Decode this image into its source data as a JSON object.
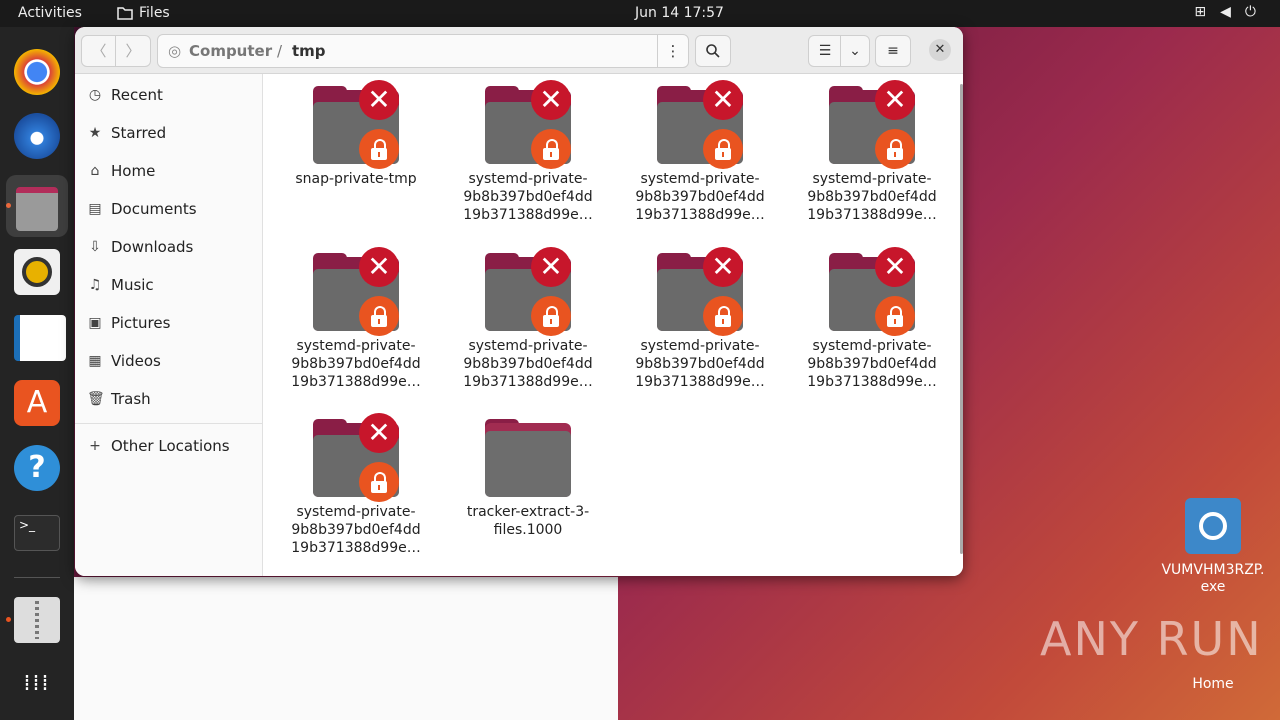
{
  "topbar": {
    "activities": "Activities",
    "app_name": "Files",
    "clock": "Jun 14  17:57",
    "tray": [
      "network-icon",
      "volume-icon",
      "power-icon"
    ]
  },
  "window": {
    "path": [
      "Computer",
      "/",
      "tmp"
    ]
  },
  "sidebar": {
    "items": [
      {
        "label": "Recent",
        "icon": "clock-icon"
      },
      {
        "label": "Starred",
        "icon": "star-icon"
      },
      {
        "label": "Home",
        "icon": "home-icon"
      },
      {
        "label": "Documents",
        "icon": "document-icon"
      },
      {
        "label": "Downloads",
        "icon": "download-icon"
      },
      {
        "label": "Music",
        "icon": "music-icon"
      },
      {
        "label": "Pictures",
        "icon": "picture-icon"
      },
      {
        "label": "Videos",
        "icon": "video-icon"
      },
      {
        "label": "Trash",
        "icon": "trash-icon"
      },
      {
        "label": "Other Locations",
        "icon": "plus-icon"
      }
    ]
  },
  "files": [
    {
      "line1": "snap-private-tmp",
      "line2": "",
      "line3": "",
      "locked": true
    },
    {
      "line1": "systemd-private-",
      "line2": "9b8b397bd0ef4dd",
      "line3": "19b371388d99e…",
      "locked": true
    },
    {
      "line1": "systemd-private-",
      "line2": "9b8b397bd0ef4dd",
      "line3": "19b371388d99e…",
      "locked": true
    },
    {
      "line1": "systemd-private-",
      "line2": "9b8b397bd0ef4dd",
      "line3": "19b371388d99e…",
      "locked": true
    },
    {
      "line1": "systemd-private-",
      "line2": "9b8b397bd0ef4dd",
      "line3": "19b371388d99e…",
      "locked": true
    },
    {
      "line1": "systemd-private-",
      "line2": "9b8b397bd0ef4dd",
      "line3": "19b371388d99e…",
      "locked": true
    },
    {
      "line1": "systemd-private-",
      "line2": "9b8b397bd0ef4dd",
      "line3": "19b371388d99e…",
      "locked": true
    },
    {
      "line1": "systemd-private-",
      "line2": "9b8b397bd0ef4dd",
      "line3": "19b371388d99e…",
      "locked": true
    },
    {
      "line1": "systemd-private-",
      "line2": "9b8b397bd0ef4dd",
      "line3": "19b371388d99e…",
      "locked": true
    },
    {
      "line1": "tracker-extract-3-",
      "line2": "files.1000",
      "line3": "",
      "locked": false
    }
  ],
  "desktop": {
    "exe_label_1": "VUMVHM3RZP.",
    "exe_label_2": "exe",
    "home_label": "Home",
    "watermark": "ANY RUN"
  },
  "colors": {
    "accent": "#e95420",
    "error_badge": "#c7162b",
    "folder_tab": "#8a1e46"
  }
}
